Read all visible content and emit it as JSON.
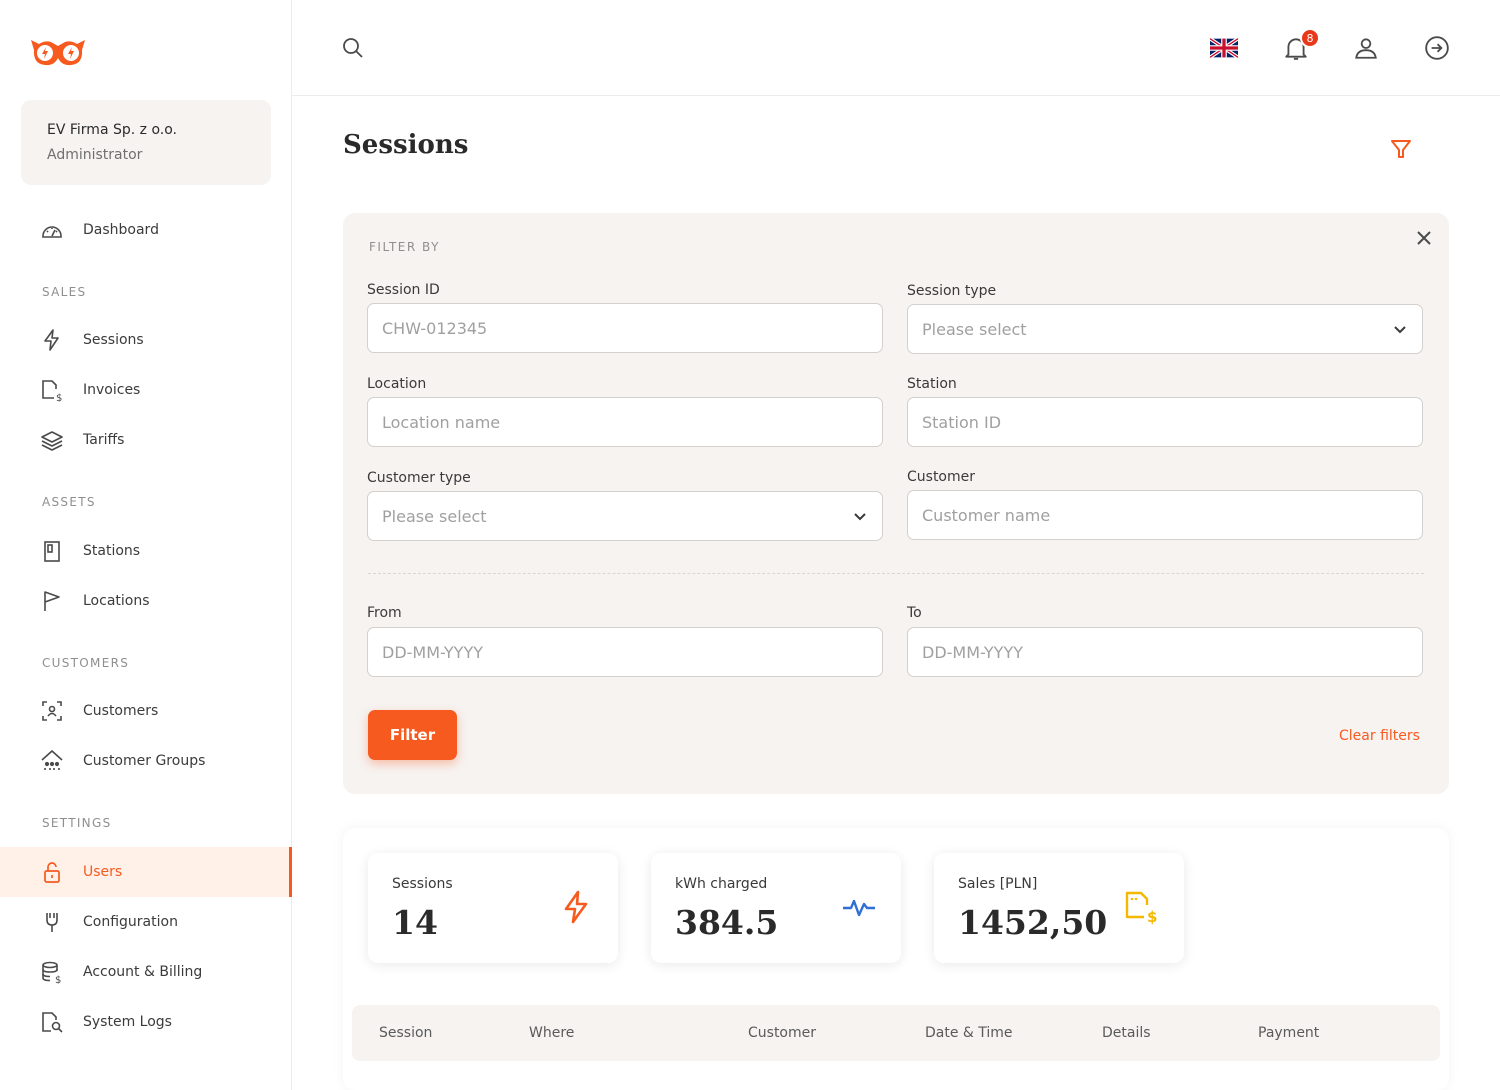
{
  "org": {
    "name": "EV Firma Sp. z o.o.",
    "role": "Administrator"
  },
  "nav": {
    "dashboard": "Dashboard",
    "sections": {
      "sales": "SALES",
      "assets": "ASSETS",
      "customers": "CUSTOMERS",
      "settings": "SETTINGS"
    },
    "sales": [
      "Sessions",
      "Invoices",
      "Tariffs"
    ],
    "assets": [
      "Stations",
      "Locations"
    ],
    "customers": [
      "Customers",
      "Customer Groups"
    ],
    "settings": [
      "Users",
      "Configuration",
      "Account & Billing",
      "System Logs"
    ]
  },
  "topbar": {
    "notification_count": "8"
  },
  "page": {
    "title": "Sessions"
  },
  "filters": {
    "heading": "FILTER BY",
    "session_id": {
      "label": "Session ID",
      "placeholder": "CHW-012345"
    },
    "session_type": {
      "label": "Session type",
      "placeholder": "Please select"
    },
    "location": {
      "label": "Location",
      "placeholder": "Location name"
    },
    "station": {
      "label": "Station",
      "placeholder": "Station ID"
    },
    "customer_type": {
      "label": "Customer type",
      "placeholder": "Please select"
    },
    "customer": {
      "label": "Customer",
      "placeholder": "Customer name"
    },
    "from": {
      "label": "From",
      "placeholder": "DD-MM-YYYY"
    },
    "to": {
      "label": "To",
      "placeholder": "DD-MM-YYYY"
    },
    "filter_button": "Filter",
    "clear_link": "Clear filters"
  },
  "stats": [
    {
      "label": "Sessions",
      "value": "14",
      "icon": "bolt-icon"
    },
    {
      "label": "kWh charged",
      "value": "384.5",
      "icon": "activity-icon"
    },
    {
      "label": "Sales [PLN]",
      "value": "1452,50",
      "icon": "invoice-dollar-icon"
    }
  ],
  "table": {
    "columns": [
      "Session",
      "Where",
      "Customer",
      "Date & Time",
      "Details",
      "Payment"
    ]
  },
  "colors": {
    "accent": "#f65a1f",
    "activity": "#2f6fd6",
    "sales": "#f5b800",
    "panel": "#f6f3f1"
  }
}
